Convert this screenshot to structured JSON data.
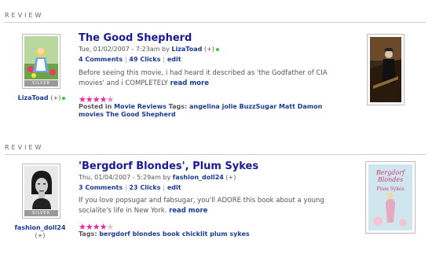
{
  "reviews": [
    {
      "section_label": "REVIEW",
      "title": "The Good Shepherd",
      "date": "Tue, 01/02/2007 - 7:23am",
      "by": "by",
      "author": "LizaToad",
      "author_suffix": "(+)",
      "comments": "4 Comments",
      "clicks": "49 Clicks",
      "edit": "edit",
      "body": "Before seeing this movie, i had heard it described as 'the Godfather of CIA movies' and i COMPLETELY",
      "read_more": "read more",
      "rating": 4.5,
      "rating_max": 5,
      "posted_prefix": "Posted in",
      "posted_category": "Movie Reviews",
      "tags_prefix": "Tags:",
      "tags": "angelina jolie BuzzSugar Matt Damon movies The Good Shepherd",
      "badge": "SILVER",
      "user_label": "LizaToad",
      "user_suffix": "(+)"
    },
    {
      "section_label": "REVIEW",
      "title": "'Bergdorf Blondes', Plum Sykes",
      "date": "Thu, 01/04/2007 - 5:29am",
      "by": "by",
      "author": "fashion_doll24",
      "author_suffix": "(+)",
      "comments": "3 Comments",
      "clicks": "23 Clicks",
      "edit": "edit",
      "body": "If you love popsugar and fabsugar, you'll ADORE this book about a young socialite's life in New York.",
      "read_more": "read more",
      "rating": 4,
      "rating_max": 5,
      "tags_prefix": "Tags:",
      "tags": "bergdorf blondes book chicklit plum sykes",
      "badge": "SILVER",
      "user_label": "fashion_doll24",
      "user_suffix": "(+)",
      "book_cover_text": [
        "Bergdorf",
        "Blondes",
        "Plum",
        "Sykes"
      ]
    }
  ],
  "colors": {
    "link": "#1a3a99",
    "title": "#1a1a99",
    "star": "#ee2a9b"
  }
}
